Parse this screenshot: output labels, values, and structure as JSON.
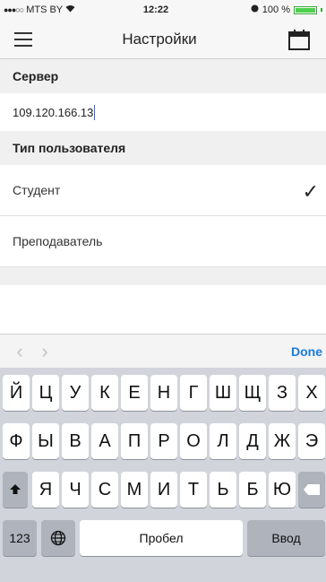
{
  "status_bar": {
    "carrier": "MTS BY",
    "time": "12:22",
    "battery": "100 %"
  },
  "navbar": {
    "title": "Настройки"
  },
  "server": {
    "header": "Сервер",
    "value": "109.120.166.13"
  },
  "user_type": {
    "header": "Тип пользователя",
    "options": [
      "Студент",
      "Преподаватель"
    ],
    "selected": "Студент"
  },
  "toolbar": {
    "done_label": "Done"
  },
  "keyboard": {
    "row1": [
      "Й",
      "Ц",
      "У",
      "К",
      "Е",
      "Н",
      "Г",
      "Ш",
      "Щ",
      "З",
      "Х"
    ],
    "row2": [
      "Ф",
      "Ы",
      "В",
      "А",
      "П",
      "Р",
      "О",
      "Л",
      "Д",
      "Ж",
      "Э"
    ],
    "row3": [
      "Я",
      "Ч",
      "С",
      "М",
      "И",
      "Т",
      "Ь",
      "Б",
      "Ю"
    ],
    "numbers_label": "123",
    "space_label": "Пробел",
    "return_label": "Ввод"
  }
}
